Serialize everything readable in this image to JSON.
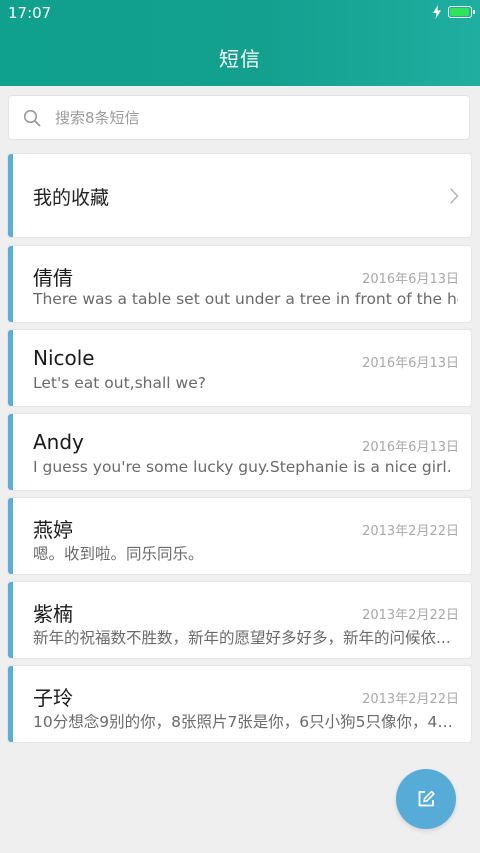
{
  "status_bar": {
    "time": "17:07",
    "battery_level": 0.95,
    "battery_color": "#2ee45a"
  },
  "header": {
    "title": "短信",
    "background": "#12a08f"
  },
  "search": {
    "placeholder": "搜索8条短信"
  },
  "favorites": {
    "label": "我的收藏"
  },
  "accent_color": "#5baed6",
  "messages": [
    {
      "name": "倩倩",
      "date": "2016年6月13日",
      "preview": "There was a table set out under a tree in front of the hous"
    },
    {
      "name": "Nicole",
      "date": "2016年6月13日",
      "preview": "Let's eat out,shall we?"
    },
    {
      "name": "Andy",
      "date": "2016年6月13日",
      "preview": "I guess you're some lucky guy.Stephanie is a nice girl."
    },
    {
      "name": "燕婷",
      "date": "2013年2月22日",
      "preview": "嗯。收到啦。同乐同乐。"
    },
    {
      "name": "紫楠",
      "date": "2013年2月22日",
      "preview": "新年的祝福数不胜数，新年的愿望好多好多，新年的问候依..."
    },
    {
      "name": "子玲",
      "date": "2013年2月22日",
      "preview": "10分想念9别的你，8张照片7张是你，6只小狗5只像你，4根..."
    }
  ],
  "compose": {
    "icon": "compose-icon",
    "color": "#56acd6"
  }
}
